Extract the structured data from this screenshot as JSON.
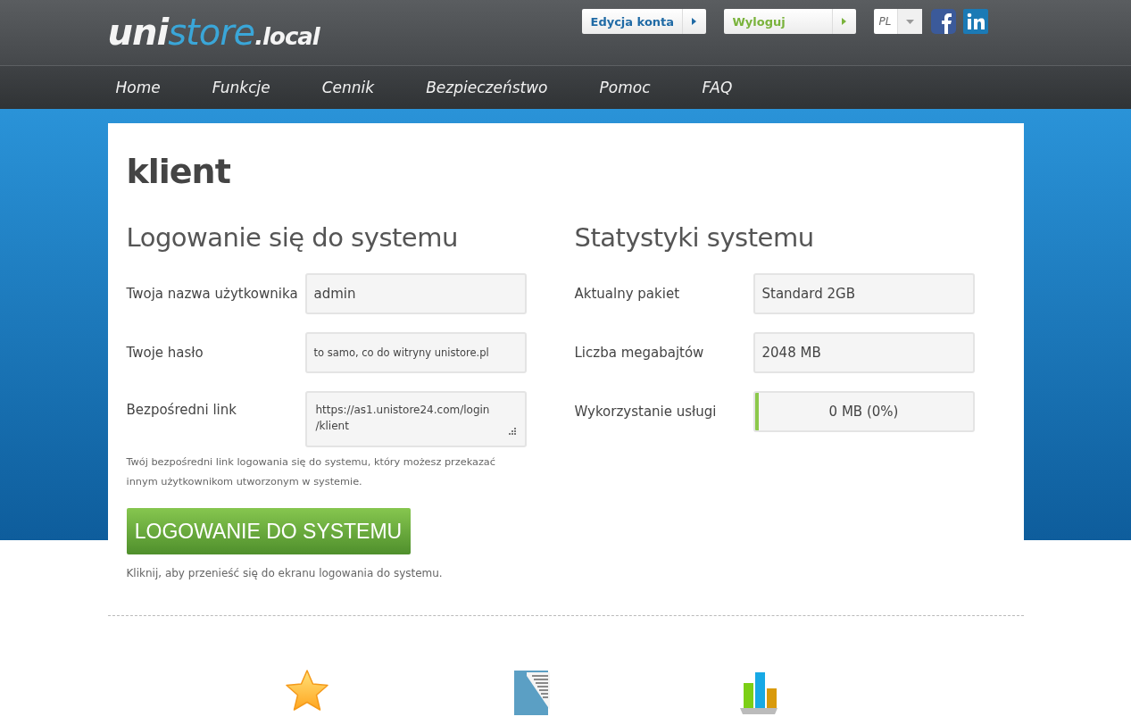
{
  "header": {
    "logo": [
      "uni",
      "store",
      ".local"
    ],
    "buttons": [
      {
        "label": "Edycja konta",
        "kind": "account"
      },
      {
        "label": "Wyloguj",
        "kind": "logout"
      }
    ],
    "language": {
      "value": "PL"
    }
  },
  "nav": [
    "Home",
    "Funkcje",
    "Cennik",
    "Bezpieczeństwo",
    "Pomoc",
    "FAQ"
  ],
  "page_title": "klient",
  "login": {
    "heading": "Logowanie się do systemu",
    "fields": [
      {
        "label": "Twoja nazwa użytkownika",
        "value": "admin",
        "kind": "text"
      },
      {
        "label": "Twoje hasło",
        "value": "to samo, co do witryny unistore.pl",
        "kind": "note"
      },
      {
        "label": "Bezpośredni link",
        "value": "https://as1.unistore24.com/login\n/klient",
        "kind": "textarea"
      }
    ],
    "help": "Twój bezpośredni link logowania się do systemu, który możesz przekazać innym użytkownikom utworzonym w systemie.",
    "button": "LOGOWANIE DO SYSTEMU",
    "hint": "Kliknij, aby przenieść się do ekranu logowania do systemu."
  },
  "stats": {
    "heading": "Statystyki systemu",
    "rows": [
      {
        "label": "Aktualny pakiet",
        "value": "Standard 2GB",
        "kind": "text"
      },
      {
        "label": "Liczba megabajtów",
        "value": "2048 MB",
        "kind": "text"
      },
      {
        "label": "Wykorzystanie usługi",
        "value": "0 MB (0%)",
        "kind": "meter",
        "level": 0
      }
    ]
  }
}
